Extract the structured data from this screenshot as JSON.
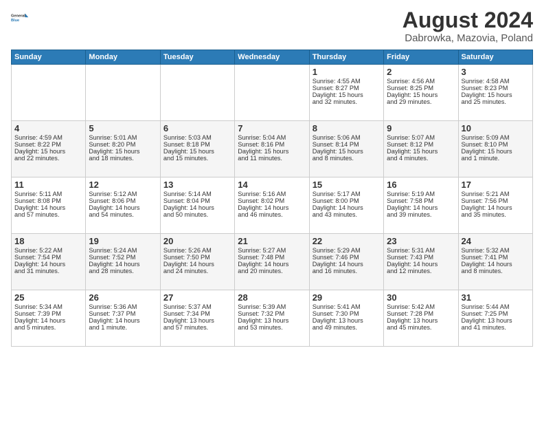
{
  "header": {
    "logo_line1": "General",
    "logo_line2": "Blue",
    "main_title": "August 2024",
    "subtitle": "Dabrowka, Mazovia, Poland"
  },
  "days_of_week": [
    "Sunday",
    "Monday",
    "Tuesday",
    "Wednesday",
    "Thursday",
    "Friday",
    "Saturday"
  ],
  "weeks": [
    [
      {
        "day": "",
        "content": ""
      },
      {
        "day": "",
        "content": ""
      },
      {
        "day": "",
        "content": ""
      },
      {
        "day": "",
        "content": ""
      },
      {
        "day": "1",
        "content": "Sunrise: 4:55 AM\nSunset: 8:27 PM\nDaylight: 15 hours\nand 32 minutes."
      },
      {
        "day": "2",
        "content": "Sunrise: 4:56 AM\nSunset: 8:25 PM\nDaylight: 15 hours\nand 29 minutes."
      },
      {
        "day": "3",
        "content": "Sunrise: 4:58 AM\nSunset: 8:23 PM\nDaylight: 15 hours\nand 25 minutes."
      }
    ],
    [
      {
        "day": "4",
        "content": "Sunrise: 4:59 AM\nSunset: 8:22 PM\nDaylight: 15 hours\nand 22 minutes."
      },
      {
        "day": "5",
        "content": "Sunrise: 5:01 AM\nSunset: 8:20 PM\nDaylight: 15 hours\nand 18 minutes."
      },
      {
        "day": "6",
        "content": "Sunrise: 5:03 AM\nSunset: 8:18 PM\nDaylight: 15 hours\nand 15 minutes."
      },
      {
        "day": "7",
        "content": "Sunrise: 5:04 AM\nSunset: 8:16 PM\nDaylight: 15 hours\nand 11 minutes."
      },
      {
        "day": "8",
        "content": "Sunrise: 5:06 AM\nSunset: 8:14 PM\nDaylight: 15 hours\nand 8 minutes."
      },
      {
        "day": "9",
        "content": "Sunrise: 5:07 AM\nSunset: 8:12 PM\nDaylight: 15 hours\nand 4 minutes."
      },
      {
        "day": "10",
        "content": "Sunrise: 5:09 AM\nSunset: 8:10 PM\nDaylight: 15 hours\nand 1 minute."
      }
    ],
    [
      {
        "day": "11",
        "content": "Sunrise: 5:11 AM\nSunset: 8:08 PM\nDaylight: 14 hours\nand 57 minutes."
      },
      {
        "day": "12",
        "content": "Sunrise: 5:12 AM\nSunset: 8:06 PM\nDaylight: 14 hours\nand 54 minutes."
      },
      {
        "day": "13",
        "content": "Sunrise: 5:14 AM\nSunset: 8:04 PM\nDaylight: 14 hours\nand 50 minutes."
      },
      {
        "day": "14",
        "content": "Sunrise: 5:16 AM\nSunset: 8:02 PM\nDaylight: 14 hours\nand 46 minutes."
      },
      {
        "day": "15",
        "content": "Sunrise: 5:17 AM\nSunset: 8:00 PM\nDaylight: 14 hours\nand 43 minutes."
      },
      {
        "day": "16",
        "content": "Sunrise: 5:19 AM\nSunset: 7:58 PM\nDaylight: 14 hours\nand 39 minutes."
      },
      {
        "day": "17",
        "content": "Sunrise: 5:21 AM\nSunset: 7:56 PM\nDaylight: 14 hours\nand 35 minutes."
      }
    ],
    [
      {
        "day": "18",
        "content": "Sunrise: 5:22 AM\nSunset: 7:54 PM\nDaylight: 14 hours\nand 31 minutes."
      },
      {
        "day": "19",
        "content": "Sunrise: 5:24 AM\nSunset: 7:52 PM\nDaylight: 14 hours\nand 28 minutes."
      },
      {
        "day": "20",
        "content": "Sunrise: 5:26 AM\nSunset: 7:50 PM\nDaylight: 14 hours\nand 24 minutes."
      },
      {
        "day": "21",
        "content": "Sunrise: 5:27 AM\nSunset: 7:48 PM\nDaylight: 14 hours\nand 20 minutes."
      },
      {
        "day": "22",
        "content": "Sunrise: 5:29 AM\nSunset: 7:46 PM\nDaylight: 14 hours\nand 16 minutes."
      },
      {
        "day": "23",
        "content": "Sunrise: 5:31 AM\nSunset: 7:43 PM\nDaylight: 14 hours\nand 12 minutes."
      },
      {
        "day": "24",
        "content": "Sunrise: 5:32 AM\nSunset: 7:41 PM\nDaylight: 14 hours\nand 8 minutes."
      }
    ],
    [
      {
        "day": "25",
        "content": "Sunrise: 5:34 AM\nSunset: 7:39 PM\nDaylight: 14 hours\nand 5 minutes."
      },
      {
        "day": "26",
        "content": "Sunrise: 5:36 AM\nSunset: 7:37 PM\nDaylight: 14 hours\nand 1 minute."
      },
      {
        "day": "27",
        "content": "Sunrise: 5:37 AM\nSunset: 7:34 PM\nDaylight: 13 hours\nand 57 minutes."
      },
      {
        "day": "28",
        "content": "Sunrise: 5:39 AM\nSunset: 7:32 PM\nDaylight: 13 hours\nand 53 minutes."
      },
      {
        "day": "29",
        "content": "Sunrise: 5:41 AM\nSunset: 7:30 PM\nDaylight: 13 hours\nand 49 minutes."
      },
      {
        "day": "30",
        "content": "Sunrise: 5:42 AM\nSunset: 7:28 PM\nDaylight: 13 hours\nand 45 minutes."
      },
      {
        "day": "31",
        "content": "Sunrise: 5:44 AM\nSunset: 7:25 PM\nDaylight: 13 hours\nand 41 minutes."
      }
    ]
  ]
}
